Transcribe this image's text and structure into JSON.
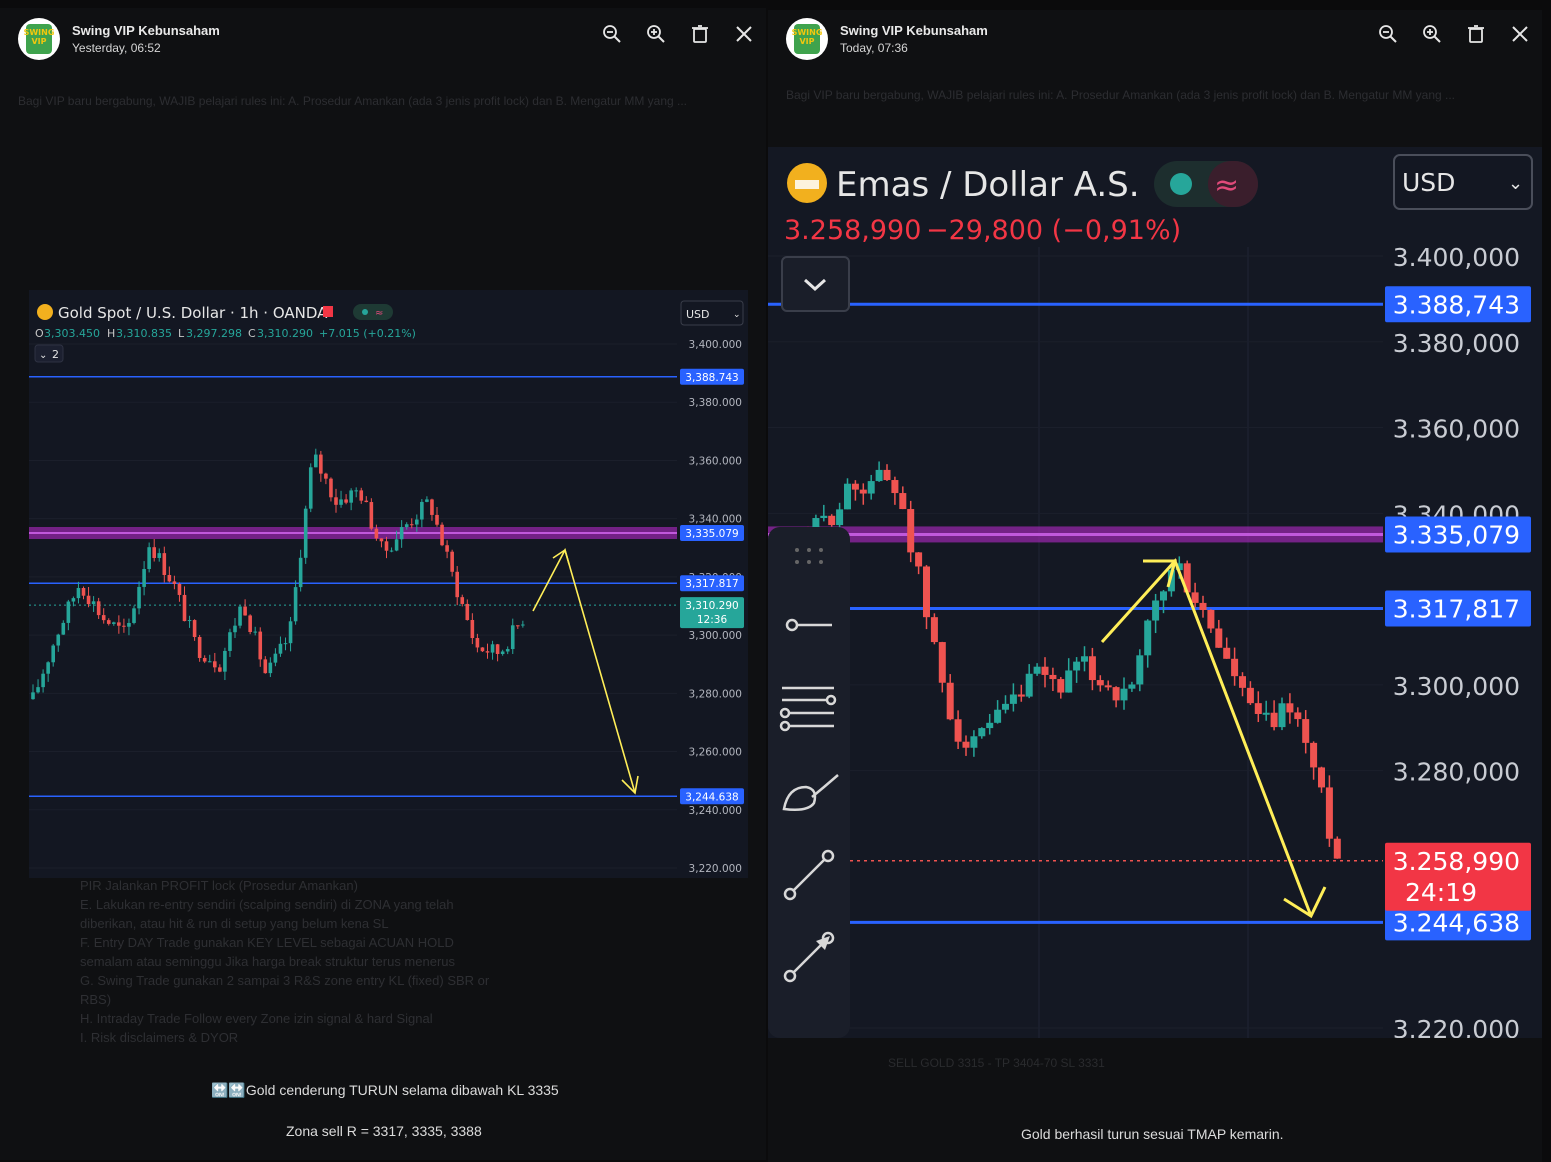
{
  "left": {
    "sender": "Swing VIP Kebunsaham",
    "timestamp": "Yesterday, 06:52",
    "avatar_text": "SWING VIP",
    "tools": [
      "zoom-out-icon",
      "zoom-in-icon",
      "trash-icon",
      "close-icon"
    ],
    "caption_line1": "🔛🔛Gold cenderung TURUN selama dibawah KL 3335",
    "caption_line2": "Zona sell R = 3317, 3335, 3388",
    "chart": {
      "title": "Gold Spot / U.S. Dollar · 1h · OANDA",
      "currency": "USD",
      "ohlc": {
        "o_label": "O",
        "o": "3,303.450",
        "h_label": "H",
        "h": "3,310.835",
        "l_label": "L",
        "l": "3,297.298",
        "c_label": "C",
        "c": "3,310.290",
        "change": "+7.015 (+0.21%)"
      },
      "indicator_toggle": "2",
      "y_ticks": [
        "3,400.000",
        "3,380.000",
        "3,360.000",
        "3,340.000",
        "3,320.000",
        "3,300.000",
        "3,280.000",
        "3,260.000",
        "3,240.000",
        "3,220.000"
      ],
      "levels": [
        {
          "label": "3,388.743",
          "value": 3388.743,
          "kind": "blue"
        },
        {
          "label": "3,335.079",
          "value": 3335.079,
          "kind": "purple"
        },
        {
          "label": "3,317.817",
          "value": 3317.817,
          "kind": "blue"
        },
        {
          "label": "3,244.638",
          "value": 3244.638,
          "kind": "blue"
        }
      ],
      "last_price": {
        "label": "3,310.290",
        "countdown": "12:36",
        "value": 3310.29
      }
    }
  },
  "right": {
    "sender": "Swing VIP Kebunsaham",
    "timestamp": "Today, 07:36",
    "avatar_text": "SWING VIP",
    "tools": [
      "zoom-out-icon",
      "zoom-in-icon",
      "trash-icon",
      "close-icon"
    ],
    "caption": "Gold berhasil turun sesuai TMAP kemarin.",
    "chart": {
      "title": "Emas / Dollar A.S.",
      "currency": "USD",
      "price": "3.258,990",
      "change": "−29,800 (−0,91%)",
      "y_ticks": [
        "3.400,000",
        "3.380,000",
        "3.360,000",
        "3.340,000",
        "3.300,000",
        "3.280,000",
        "3.220,000"
      ],
      "levels": [
        {
          "label": "3.388,743",
          "value": 3388.743,
          "kind": "blue"
        },
        {
          "label": "3.335,079",
          "value": 3335.079,
          "kind": "purple"
        },
        {
          "label": "3.317,817",
          "value": 3317.817,
          "kind": "blue"
        },
        {
          "label": "3.244,638",
          "value": 3244.638,
          "kind": "blue"
        }
      ],
      "last_price": {
        "label": "3.258,990",
        "countdown": "24:19",
        "value": 3258.99
      }
    }
  },
  "colors": {
    "bg": "#131722",
    "blue_line": "#2962ff",
    "purple_band": "#9c27b0",
    "up": "#26a69a",
    "down": "#ef5350",
    "arrow": "#ffee58",
    "price_tag_green": "#26a69a",
    "price_tag_red": "#f23645",
    "level_tag": "#2962ff"
  }
}
